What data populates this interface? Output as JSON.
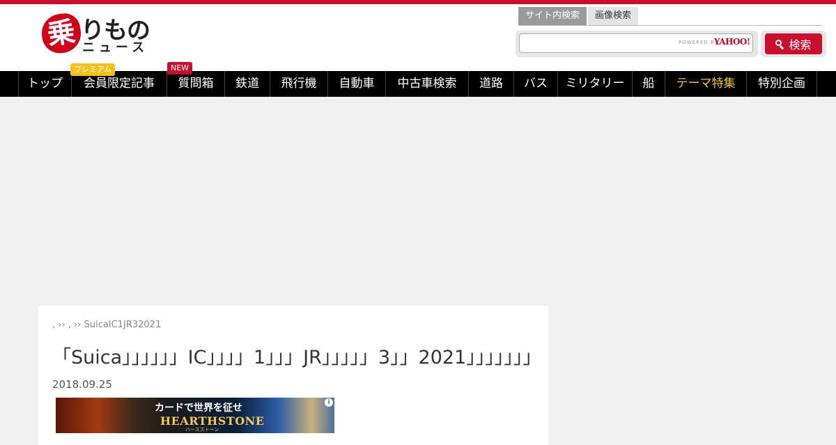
{
  "logo": {
    "mark": "乗",
    "word1": "りもの",
    "word2": "ニュース"
  },
  "search": {
    "tabs": [
      {
        "label": "サイト内検索",
        "active": true
      },
      {
        "label": "画像検索",
        "active": false
      }
    ],
    "input_value": "",
    "powered_by": "POWERED BY",
    "provider": "YAHOO!",
    "button_label": "検索",
    "button_icon": "search-icon"
  },
  "nav": {
    "items": [
      {
        "label": "トップ"
      },
      {
        "label": "会員限定記事"
      },
      {
        "label": "質問箱"
      },
      {
        "label": "鉄道"
      },
      {
        "label": "飛行機"
      },
      {
        "label": "自動車"
      },
      {
        "label": "中古車検索"
      },
      {
        "label": "道路"
      },
      {
        "label": "バス"
      },
      {
        "label": "ミリタリー"
      },
      {
        "label": "船"
      },
      {
        "label": "テーマ特集"
      },
      {
        "label": "特別企画"
      }
    ],
    "badge_premium": "プレミアム",
    "badge_new": "NEW"
  },
  "article": {
    "breadcrumb": ", ›› , ›› SuicaIC1JR32021",
    "title": "「Suica」」」」」」IC」」」」1」」」JR」」」」」3」」2021」」」」」」」",
    "date": "2018.09.25"
  },
  "banner": {
    "headline": "カードで世界を征せ",
    "brand": "HEARTHSTONE",
    "sub": "ハースストーン",
    "info": "i"
  },
  "colors": {
    "brand_red": "#c8102e",
    "nav_bg": "#000000",
    "highlight": "#f5c542"
  }
}
